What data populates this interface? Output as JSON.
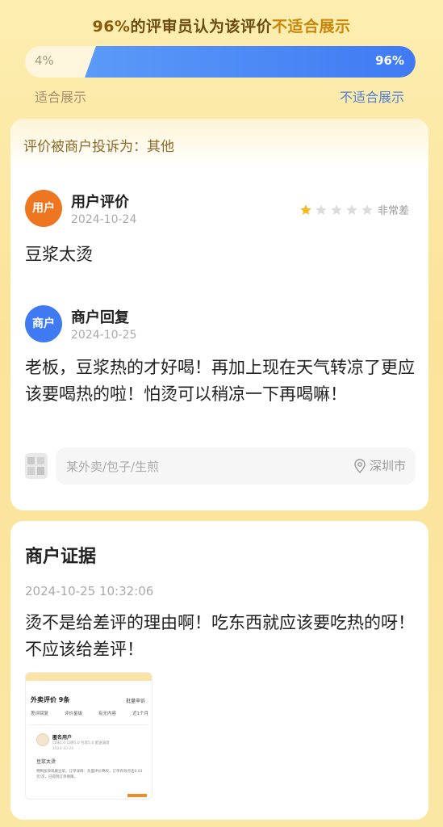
{
  "vote": {
    "title_pct": "96%",
    "title_mid": "的评审员认为该评价",
    "title_hl": "不适合展示",
    "left_pct": "4%",
    "right_pct": "96%",
    "left_fraction": 0.04,
    "right_fraction": 0.96,
    "left_label": "适合展示",
    "right_label": "不适合展示"
  },
  "complaint": {
    "header": "评价被商户投诉为：其他"
  },
  "user_review": {
    "avatar_label": "用户",
    "title": "用户评价",
    "date": "2024-10-24",
    "rating": 1,
    "rating_max": 5,
    "rating_text": "非常差",
    "text": "豆浆太烫"
  },
  "merchant_reply": {
    "avatar_label": "商户",
    "title": "商户回复",
    "date": "2024-10-25",
    "text": "老板，豆浆热的才好喝！再加上现在天气转凉了更应该要喝热的啦！怕烫可以稍凉一下再喝嘛！"
  },
  "shop": {
    "name": "某外卖/包子/生煎",
    "location": "深圳市"
  },
  "evidence": {
    "title": "商户证据",
    "time": "2024-10-25 10:32:06",
    "text": "烫不是给差评的理由啊！吃东西就应该要吃热的呀！不应该给差评！",
    "thumb": {
      "heading": "外卖评价 9条",
      "action": "批量申诉",
      "filters": [
        "差评回复",
        "评价星级",
        "有无内容",
        "近1个月"
      ],
      "name": "匿名用户",
      "meta": "口味1.0 口感5.0 包装5.0 配送满意",
      "date": "2024-10-24",
      "body": "豆浆太烫",
      "note": "特制加添现磨豆浆。订单详情：负面评价降权，订单有效点击0.03元/次，已得到订单保障。"
    }
  },
  "colors": {
    "accent_blue": "#3f7af3",
    "accent_orange": "#ee7620",
    "star_active": "#f5b81f",
    "star_inactive": "#dcdcdc"
  }
}
